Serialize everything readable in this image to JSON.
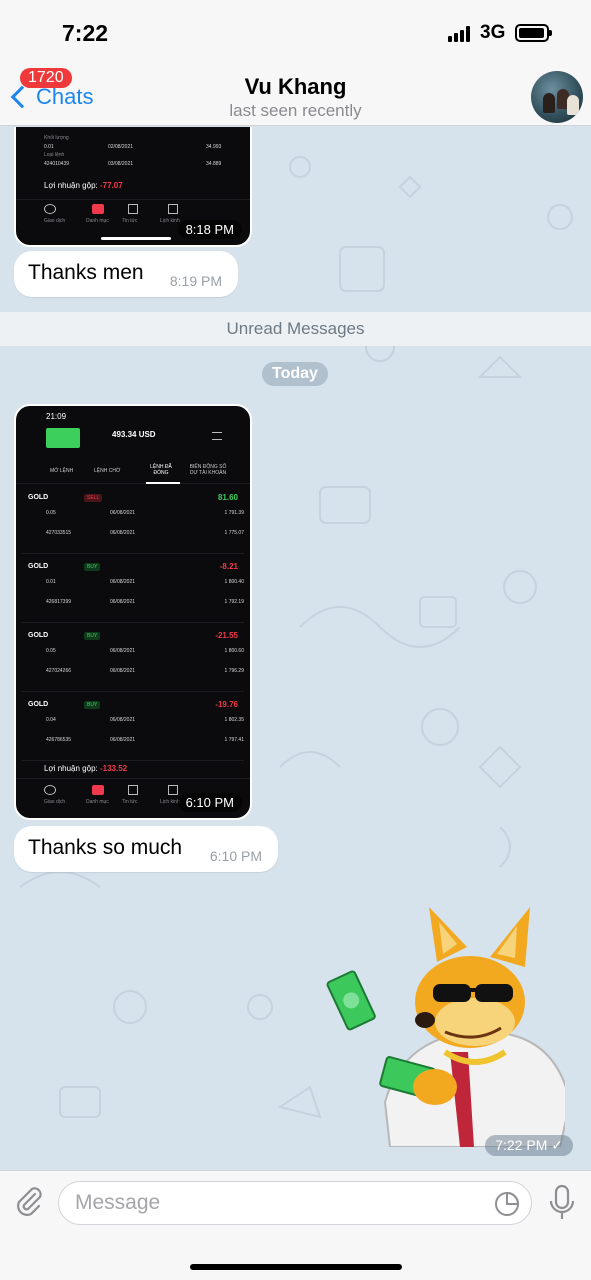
{
  "status_bar": {
    "time": "7:22",
    "network": "3G"
  },
  "header": {
    "back_label": "Chats",
    "unread_badge": "1720",
    "title": "Vu Khang",
    "subtitle": "last seen recently"
  },
  "messages": {
    "shot1_time": "8:18 PM",
    "shot1_profit_label": "Lợi nhuận gộp:",
    "shot1_profit_value": "-77.07",
    "shot1_rows": [
      {
        "qty": "0.01",
        "ticket": "424010439",
        "open": "02/08/2021",
        "close": "03/08/2021",
        "price_open": "34.993",
        "price_close": "34.889"
      }
    ],
    "bubble1_text": "Thanks men",
    "bubble1_time": "8:19 PM",
    "unread_label": "Unread Messages",
    "date_label": "Today",
    "shot2_time": "6:10 PM",
    "shot2_phone_time": "21:09",
    "shot2_balance": "493.34 USD",
    "shot2_tabs": [
      "MỞ LỆNH",
      "LỆNH CHỜ",
      "LỆNH ĐÃ ĐÓNG",
      "BIẾN ĐỘNG SỐ DƯ TÀI KHOẢN"
    ],
    "shot2_rows": [
      {
        "symbol": "GOLD",
        "side": "SELL",
        "pnl": "81.60",
        "qty": "0.05",
        "ticket": "427033515",
        "open": "06/08/2021",
        "close": "06/08/2021",
        "price_open": "1 791.39",
        "price_close": "1 775.07"
      },
      {
        "symbol": "GOLD",
        "side": "BUY",
        "pnl": "-8.21",
        "qty": "0.01",
        "ticket": "426817399",
        "open": "06/08/2021",
        "close": "06/08/2021",
        "price_open": "1 800.40",
        "price_close": "1 792.19"
      },
      {
        "symbol": "GOLD",
        "side": "BUY",
        "pnl": "-21.55",
        "qty": "0.05",
        "ticket": "427024266",
        "open": "06/08/2021",
        "close": "06/08/2021",
        "price_open": "1 800.60",
        "price_close": "1 796.29"
      },
      {
        "symbol": "GOLD",
        "side": "BUY",
        "pnl": "-19.76",
        "qty": "0.04",
        "ticket": "426786535",
        "open": "06/08/2021",
        "close": "06/08/2021",
        "price_open": "1 802.35",
        "price_close": "1 797.41"
      }
    ],
    "shot2_profit_label": "Lợi nhuận gộp:",
    "shot2_profit_value": "-133.52",
    "shot_nav": [
      "Giao dịch",
      "Danh mục",
      "Tin tức",
      "Lịch kinh"
    ],
    "bubble2_text": "Thanks so much",
    "bubble2_time": "6:10 PM",
    "sticker_time": "7:22 PM"
  },
  "composer": {
    "placeholder": "Message"
  },
  "colors": {
    "accent": "#1c85ee",
    "badge": "#f0393b",
    "profit": "#3ccf5b",
    "loss": "#f0394b"
  }
}
